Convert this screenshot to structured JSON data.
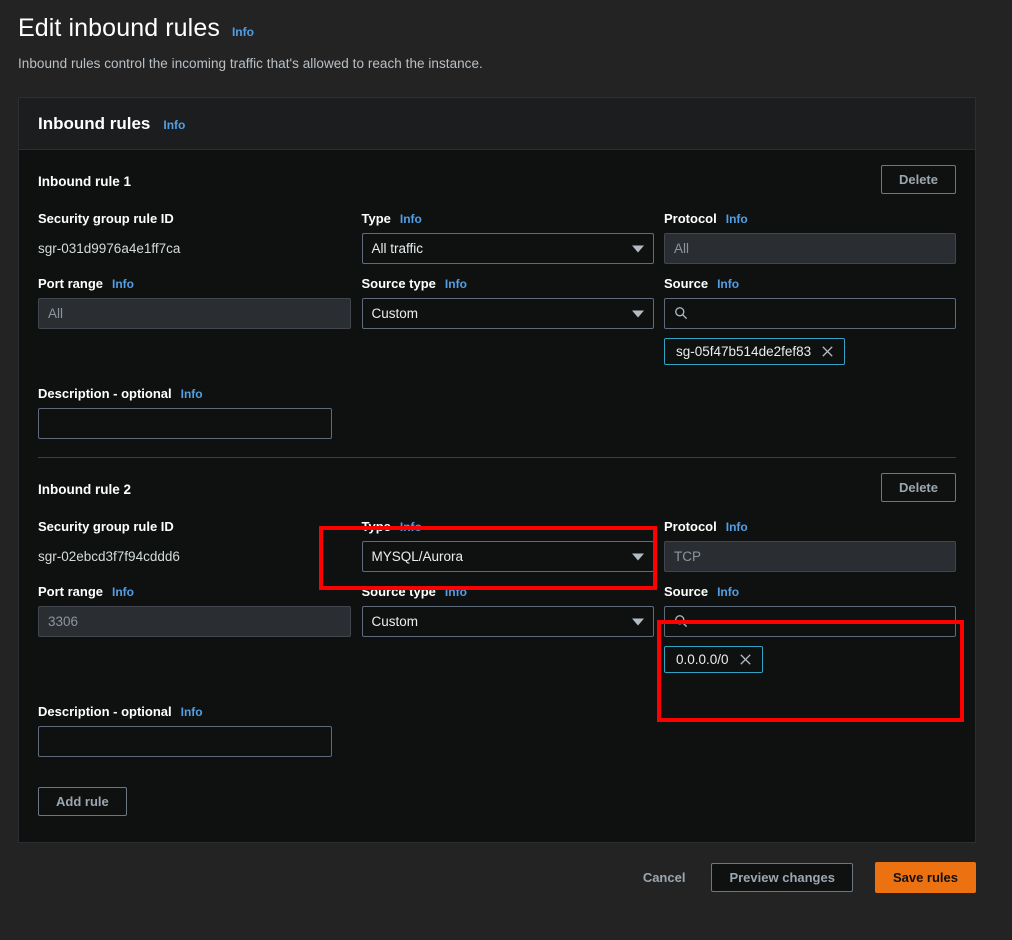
{
  "header": {
    "title": "Edit inbound rules",
    "info": "Info",
    "description": "Inbound rules control the incoming traffic that's allowed to reach the instance."
  },
  "card": {
    "title": "Inbound rules",
    "info": "Info"
  },
  "labels": {
    "security_group_rule_id": "Security group rule ID",
    "port_range": "Port range",
    "description": "Description - optional",
    "type": "Type",
    "source_type": "Source type",
    "protocol": "Protocol",
    "source": "Source",
    "info": "Info",
    "delete": "Delete"
  },
  "rules": [
    {
      "title": "Inbound rule 1",
      "rule_id": "sgr-031d9976a4e1ff7ca",
      "port_range": "All",
      "description_value": "",
      "type": "All traffic",
      "source_type": "Custom",
      "protocol": "All",
      "source_search": "",
      "source_tokens": [
        "sg-05f47b514de2fef83"
      ]
    },
    {
      "title": "Inbound rule 2",
      "rule_id": "sgr-02ebcd3f7f94cddd6",
      "port_range": "3306",
      "description_value": "",
      "type": "MYSQL/Aurora",
      "source_type": "Custom",
      "protocol": "TCP",
      "source_search": "",
      "source_tokens": [
        "0.0.0.0/0"
      ]
    }
  ],
  "add_rule_label": "Add rule",
  "footer": {
    "cancel": "Cancel",
    "preview": "Preview changes",
    "save": "Save rules"
  },
  "colors": {
    "accent_orange": "#ec7211",
    "info_blue": "#539fe5",
    "token_border": "#2fa3c4",
    "highlight_red": "#ff0000",
    "page_bg": "#232323",
    "card_bg": "#0f1111"
  }
}
